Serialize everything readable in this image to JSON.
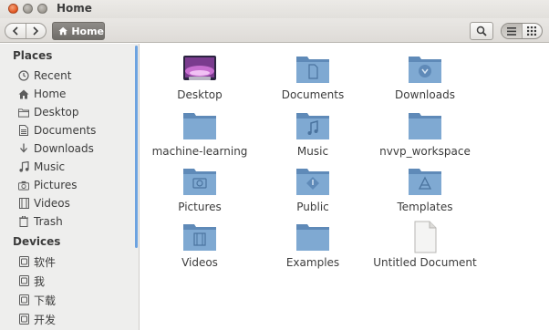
{
  "window": {
    "title": "Home"
  },
  "toolbar": {
    "path_label": "Home"
  },
  "sidebar": {
    "places_heading": "Places",
    "places": [
      {
        "label": "Recent",
        "icon": "clock-icon"
      },
      {
        "label": "Home",
        "icon": "home-icon"
      },
      {
        "label": "Desktop",
        "icon": "folder-icon"
      },
      {
        "label": "Documents",
        "icon": "document-icon"
      },
      {
        "label": "Downloads",
        "icon": "download-icon"
      },
      {
        "label": "Music",
        "icon": "music-icon"
      },
      {
        "label": "Pictures",
        "icon": "camera-icon"
      },
      {
        "label": "Videos",
        "icon": "film-icon"
      },
      {
        "label": "Trash",
        "icon": "trash-icon"
      }
    ],
    "devices_heading": "Devices",
    "devices": [
      {
        "label": "软件",
        "icon": "drive-icon"
      },
      {
        "label": "我",
        "icon": "drive-icon"
      },
      {
        "label": "下载",
        "icon": "drive-icon"
      },
      {
        "label": "开发",
        "icon": "drive-icon"
      }
    ]
  },
  "files": [
    {
      "label": "Desktop",
      "icon": "desktop-folder-icon"
    },
    {
      "label": "Documents",
      "icon": "documents-folder-icon"
    },
    {
      "label": "Downloads",
      "icon": "downloads-folder-icon"
    },
    {
      "label": "machine-learning",
      "icon": "folder-icon"
    },
    {
      "label": "Music",
      "icon": "music-folder-icon"
    },
    {
      "label": "nvvp_workspace",
      "icon": "folder-icon"
    },
    {
      "label": "Pictures",
      "icon": "pictures-folder-icon"
    },
    {
      "label": "Public",
      "icon": "public-folder-icon"
    },
    {
      "label": "Templates",
      "icon": "templates-folder-icon"
    },
    {
      "label": "Videos",
      "icon": "videos-folder-icon"
    },
    {
      "label": "Examples",
      "icon": "folder-icon"
    },
    {
      "label": "Untitled Document",
      "icon": "text-document-icon"
    }
  ],
  "colors": {
    "folder": "#7fa9d2",
    "folder_dark": "#5f8ab8",
    "accent": "#6da3e0",
    "close_button": "#e2541f"
  }
}
